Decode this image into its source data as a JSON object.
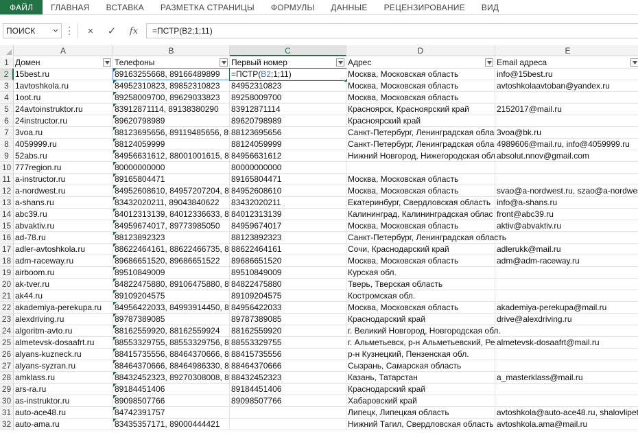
{
  "ribbon": {
    "tabs": [
      "ФАЙЛ",
      "ГЛАВНАЯ",
      "ВСТАВКА",
      "РАЗМЕТКА СТРАНИЦЫ",
      "ФОРМУЛЫ",
      "ДАННЫЕ",
      "РЕЦЕНЗИРОВАНИЕ",
      "ВИД"
    ]
  },
  "formula_bar": {
    "name_box": "ПОИСК",
    "cancel_icon": "×",
    "enter_icon": "✓",
    "fx_label": "fx",
    "formula": "=ПСТР(B2;1;11)"
  },
  "colors": {
    "accent": "#217346",
    "ref": "#4472c4"
  },
  "columns": [
    "A",
    "B",
    "C",
    "D",
    "E"
  ],
  "header_row": [
    "Домен",
    "Телефоны",
    "Первый номер",
    "Адрес",
    "Email адреса"
  ],
  "edit": {
    "prefix": "=ПСТР(",
    "ref": "B2",
    "suffix": ";1;11)"
  },
  "rows": [
    [
      "15best.ru",
      "89163255668, 89166489899",
      "",
      "Москва, Московская область",
      "info@15best.ru"
    ],
    [
      "1avtoshkola.ru",
      "84952310823, 89852310823",
      "84952310823",
      "Москва, Московская область",
      "avtoshkolaavtoban@yandex.ru"
    ],
    [
      "1oot.ru",
      "89258009700, 89629033823",
      "89258009700",
      "Москва, Московская область",
      ""
    ],
    [
      "24avtoinstruktor.ru",
      "83912871114, 89138380290",
      "83912871114",
      "Красноярск, Красноярский край",
      "2152017@mail.ru"
    ],
    [
      "24instructor.ru",
      "89620798989",
      "89620798989",
      "Красноярский край",
      ""
    ],
    [
      "3voa.ru",
      "88123695656, 89119485656, 8921",
      "88123695656",
      "Санкт-Петербург, Ленинградская облас",
      "3voa@bk.ru"
    ],
    [
      "4059999.ru",
      "88124059999",
      "88124059999",
      "Санкт-Петербург, Ленинградская облас",
      "4989606@mail.ru, info@4059999.ru"
    ],
    [
      "52abs.ru",
      "84956631612, 88001001615, 8812",
      "84956631612",
      "Нижний Новгород, Нижегородская обла",
      "absolut.nnov@gmail.com"
    ],
    [
      "777region.ru",
      "80000000000",
      "80000000000",
      "",
      ""
    ],
    [
      "a-instructor.ru",
      "89165804471",
      "89165804471",
      "Москва, Московская область",
      ""
    ],
    [
      "a-nordwest.ru",
      "84952608610, 84957207204, 8499",
      "84952608610",
      "Москва, Московская область",
      "svao@a-nordwest.ru, szao@a-nordwes"
    ],
    [
      "a-shans.ru",
      "83432020211, 89043840622",
      "83432020211",
      "Екатеринбург, Свердловская область",
      "info@a-shans.ru"
    ],
    [
      "abc39.ru",
      "84012313139, 84012336633, 8401",
      "84012313139",
      "Калининград, Калининградская облас",
      "front@abc39.ru"
    ],
    [
      "abvaktiv.ru",
      "84959674017, 89773985050",
      "84959674017",
      "Москва, Московская область",
      "aktiv@abvaktiv.ru"
    ],
    [
      "ad-78.ru",
      "88123892323",
      "88123892323",
      "Санкт-Петербург, Ленинградская область",
      ""
    ],
    [
      "adler-avtoshkola.ru",
      "88622464161, 88622466735, 8862",
      "88622464161",
      "Сочи, Краснодарский край",
      "adlerukk@mail.ru"
    ],
    [
      "adm-raceway.ru",
      "89686651520, 89686651522",
      "89686651520",
      "Москва, Московская область",
      "adm@adm-raceway.ru"
    ],
    [
      "airboom.ru",
      "89510849009",
      "89510849009",
      "Курская обл.",
      ""
    ],
    [
      "ak-tver.ru",
      "84822475880, 89106475880, 8919",
      "84822475880",
      "Тверь, Тверская область",
      ""
    ],
    [
      "ak44.ru",
      "89109204575",
      "89109204575",
      "Костромская обл.",
      ""
    ],
    [
      "akademiya-perekupa.ru",
      "84956422033, 84993914450, 8929",
      "84956422033",
      "Москва, Московская область",
      "akademiya-perekupa@mail.ru"
    ],
    [
      "alexdriving.ru",
      "89787389085",
      "89787389085",
      "Краснодарский край",
      "drive@alexdriving.ru"
    ],
    [
      "algoritm-avto.ru",
      "88162559920, 88162559924",
      "88162559920",
      "г. Великий Новгород, Новгородская обл.",
      ""
    ],
    [
      "almetevsk-dosaafrt.ru",
      "88553329755, 88553329756, 8855",
      "88553329755",
      "г. Альметьевск, р-н Альметьевский, Рес",
      "almetevsk-dosaafrt@mail.ru"
    ],
    [
      "alyans-kuzneck.ru",
      "88415735556, 88464370666, 8937",
      "88415735556",
      "р-н Кузнецкий, Пензенская обл.",
      ""
    ],
    [
      "alyans-syzran.ru",
      "88464370666, 88464986330, 8927",
      "88464370666",
      "Сызрань, Самарская область",
      ""
    ],
    [
      "amklass.ru",
      "88432452323, 89270308008, 8937",
      "88432452323",
      "Казань, Татарстан",
      "a_masterklass@mail.ru"
    ],
    [
      "ars-ra.ru",
      "89184451406",
      "89184451406",
      "Краснодарский край",
      ""
    ],
    [
      "as-instruktor.ru",
      "89098507766",
      "89098507766",
      "Хабаровский край",
      ""
    ],
    [
      "auto-ace48.ru",
      "84742391757",
      "",
      "Липецк, Липецкая область",
      "avtoshkola@auto-ace48.ru, shalovlipet"
    ],
    [
      "auto-ama.ru",
      "83435357171, 89000444421",
      "",
      "Нижний Тагил, Свердловская область",
      "avtoshkola.ama@mail.ru"
    ]
  ]
}
